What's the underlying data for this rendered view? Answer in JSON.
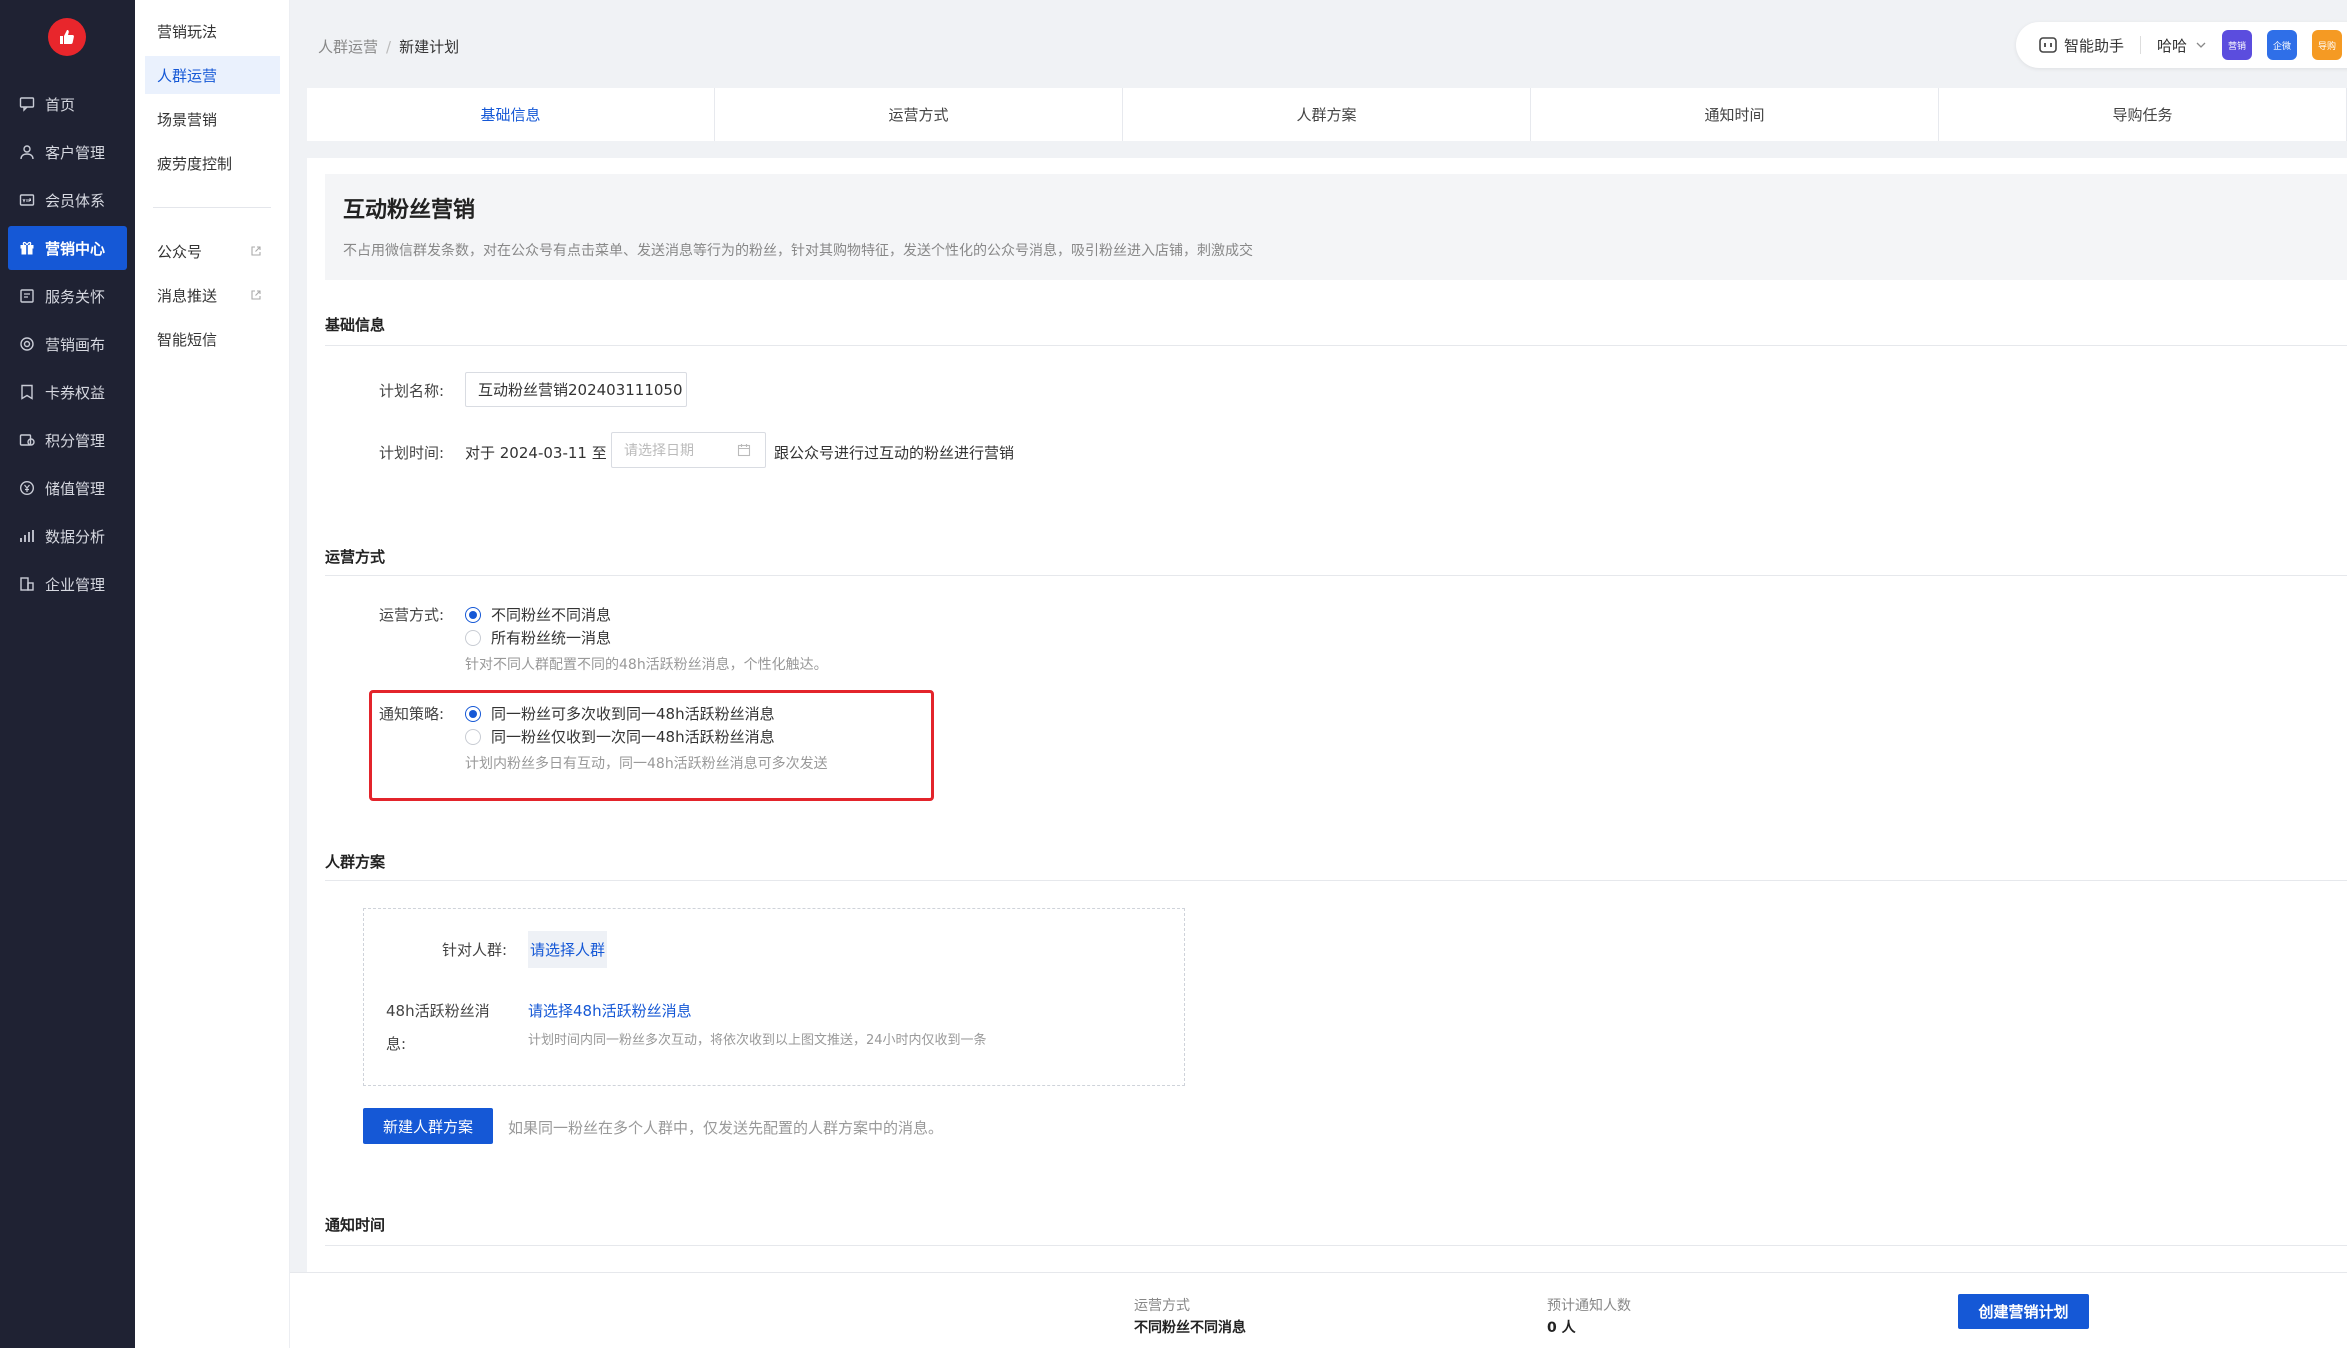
{
  "nav": {
    "items": [
      {
        "label": "首页",
        "icon": "chat-icon"
      },
      {
        "label": "客户管理",
        "icon": "user-icon"
      },
      {
        "label": "会员体系",
        "icon": "vip-card-icon"
      },
      {
        "label": "营销中心",
        "icon": "gift-icon",
        "active": true
      },
      {
        "label": "服务关怀",
        "icon": "service-icon"
      },
      {
        "label": "营销画布",
        "icon": "target-icon"
      },
      {
        "label": "卡券权益",
        "icon": "coupon-icon"
      },
      {
        "label": "积分管理",
        "icon": "points-icon"
      },
      {
        "label": "储值管理",
        "icon": "wallet-icon"
      },
      {
        "label": "数据分析",
        "icon": "chart-icon"
      },
      {
        "label": "企业管理",
        "icon": "building-icon"
      }
    ]
  },
  "subnav": {
    "items": [
      {
        "label": "营销玩法"
      },
      {
        "label": "人群运营",
        "active": true
      },
      {
        "label": "场景营销"
      },
      {
        "label": "疲劳度控制"
      },
      {
        "label": "公众号",
        "external": true
      },
      {
        "label": "消息推送",
        "external": true
      },
      {
        "label": "智能短信"
      }
    ]
  },
  "breadcrumb": {
    "parent": "人群运营",
    "separator": "/",
    "current": "新建计划"
  },
  "topbar": {
    "assistant": "智能助手",
    "user": "哈哈",
    "apps": [
      {
        "label": "营销",
        "color": "#5b4dde"
      },
      {
        "label": "企微",
        "color": "#2f6fe8"
      },
      {
        "label": "导购",
        "color": "#f59a23"
      }
    ]
  },
  "steps": [
    "基础信息",
    "运营方式",
    "人群方案",
    "通知时间",
    "导购任务"
  ],
  "intro": {
    "title": "互动粉丝营销",
    "desc": "不占用微信群发条数，对在公众号有点击菜单、发送消息等行为的粉丝，针对其购物特征，发送个性化的公众号消息，吸引粉丝进入店铺，刺激成交"
  },
  "basic": {
    "section_title": "基础信息",
    "name_label": "计划名称:",
    "name_value": "互动粉丝营销202403111050",
    "time_label": "计划时间:",
    "time_prefix": "对于 2024-03-11 至",
    "date_placeholder": "请选择日期",
    "time_suffix": "跟公众号进行过互动的粉丝进行营销"
  },
  "operation": {
    "section_title": "运营方式",
    "mode_label": "运营方式:",
    "mode_options": [
      "不同粉丝不同消息",
      "所有粉丝统一消息"
    ],
    "mode_hint": "针对不同人群配置不同的48h活跃粉丝消息，个性化触达。",
    "strategy_label": "通知策略:",
    "strategy_options": [
      "同一粉丝可多次收到同一48h活跃粉丝消息",
      "同一粉丝仅收到一次同一48h活跃粉丝消息"
    ],
    "strategy_hint": "计划内粉丝多日有互动，同一48h活跃粉丝消息可多次发送"
  },
  "audience": {
    "section_title": "人群方案",
    "target_label": "针对人群:",
    "target_link": "请选择人群",
    "msg_label_line1": "48h活跃粉丝消",
    "msg_label_line2": "息:",
    "msg_link": "请选择48h活跃粉丝消息",
    "msg_hint": "计划时间内同一粉丝多次互动，将依次收到以上图文推送，24小时内仅收到一条",
    "new_button": "新建人群方案",
    "new_hint": "如果同一粉丝在多个人群中，仅发送先配置的人群方案中的消息。"
  },
  "notify": {
    "section_title": "通知时间"
  },
  "footer": {
    "mode_label": "运营方式",
    "mode_value": "不同粉丝不同消息",
    "count_label": "预计通知人数",
    "count_value": "0 人",
    "create_button": "创建营销计划"
  }
}
